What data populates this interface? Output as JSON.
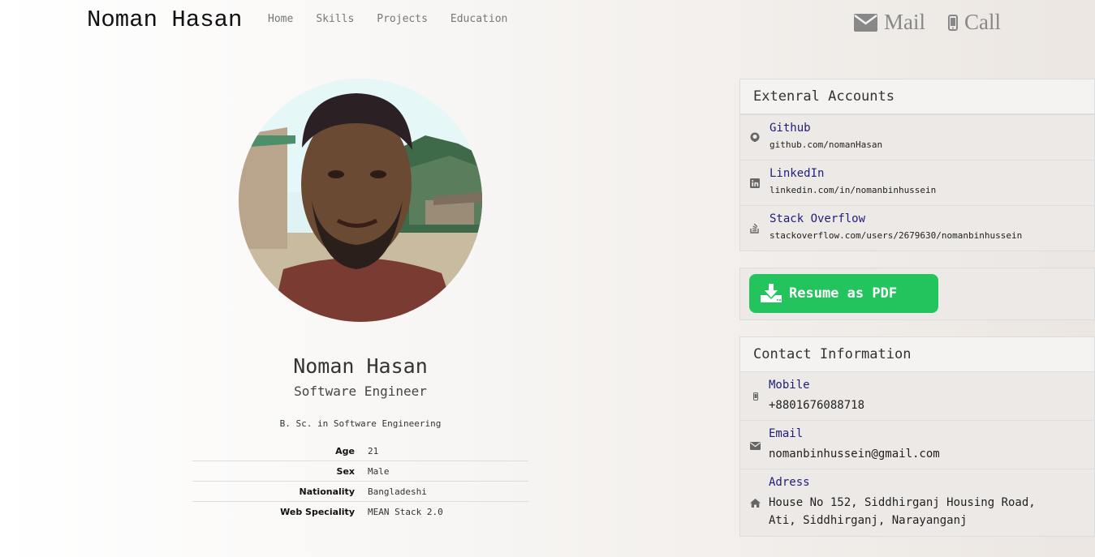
{
  "header": {
    "brand": "Noman Hasan",
    "nav": [
      "Home",
      "Skills",
      "Projects",
      "Education"
    ],
    "mail_label": "Mail",
    "call_label": "Call"
  },
  "profile": {
    "name": "Noman Hasan",
    "title": "Software Engineer",
    "degree": "B. Sc. in Software Engineering",
    "info": [
      {
        "key": "Age",
        "value": "21"
      },
      {
        "key": "Sex",
        "value": "Male"
      },
      {
        "key": "Nationality",
        "value": "Bangladeshi"
      },
      {
        "key": "Web Speciality",
        "value": "MEAN Stack 2.0"
      }
    ]
  },
  "external": {
    "heading": "Extenral Accounts",
    "accounts": [
      {
        "name": "Github",
        "url": "github.com/nomanHasan",
        "icon": "github-icon"
      },
      {
        "name": "LinkedIn",
        "url": "linkedin.com/in/nomanbinhussein",
        "icon": "linkedin-icon"
      },
      {
        "name": "Stack Overflow",
        "url": "stackoverflow.com/users/2679630/nomanbinhussein",
        "icon": "stackoverflow-icon"
      }
    ]
  },
  "resume": {
    "label": "Resume as PDF"
  },
  "contact": {
    "heading": "Contact Information",
    "mobile_label": "Mobile",
    "mobile_value": "+8801676088718",
    "email_label": "Email",
    "email_value": "nomanbinhussein@gmail.com",
    "address_label": "Adress",
    "address_line1": "House No 152, Siddhirganj Housing Road,",
    "address_line2": "Ati, Siddhirganj, Narayanganj"
  },
  "colors": {
    "link": "#1f1c7a",
    "button": "#23c45e",
    "muted": "#888888"
  }
}
